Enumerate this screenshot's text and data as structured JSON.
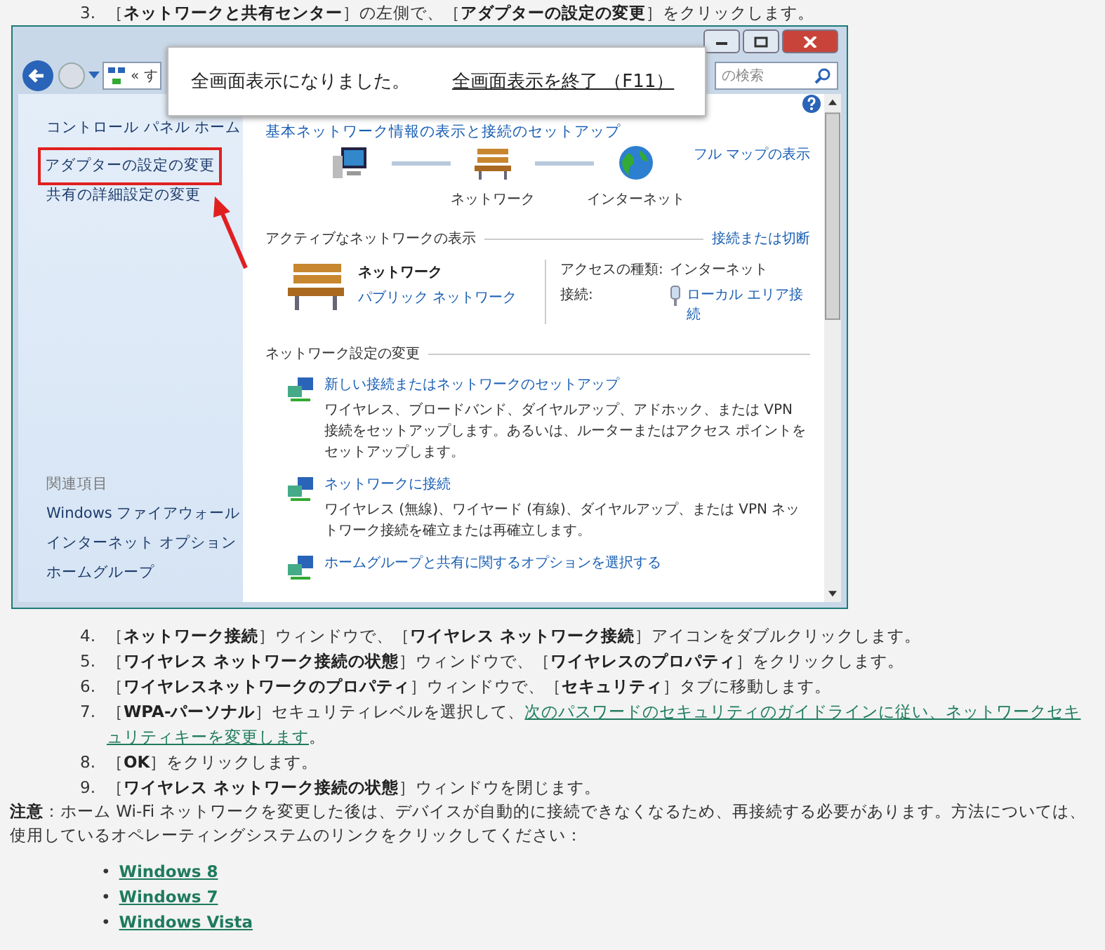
{
  "intro_step": {
    "number": "3.",
    "text": "［**ネットワークと共有センター**］の左側で、［**アダプターの設定の変更**］をクリックします。"
  },
  "screenshot": {
    "address": "« す",
    "search_placeholder": "の検索",
    "banner": {
      "message": "全画面表示になりました。",
      "exit_link": "全画面表示を終了 （F11）"
    },
    "sidebar": {
      "home": "コントロール パネル ホーム",
      "items": [
        {
          "label": "アダプターの設定の変更",
          "highlighted": true
        },
        {
          "label": "共有の詳細設定の変更",
          "highlighted": false
        }
      ],
      "related_heading": "関連項目",
      "related": [
        "Windows ファイアウォール",
        "インターネット オプション",
        "ホームグループ"
      ]
    },
    "main": {
      "heading": "基本ネットワーク情報の表示と接続のセットアップ",
      "full_map_link": "フル マップの表示",
      "map_nodes": [
        {
          "kind": "computer"
        },
        {
          "kind": "bench",
          "label": "ネットワーク"
        },
        {
          "kind": "globe",
          "label": "インターネット"
        }
      ],
      "active_heading": "アクティブなネットワークの表示",
      "connect_link": "接続または切断",
      "network_name": "ネットワーク",
      "network_type": "パブリック ネットワーク",
      "access_label": "アクセスの種類:",
      "access_value": "インターネット",
      "connection_label": "接続:",
      "connection_value": "ローカル エリア接続",
      "change_heading": "ネットワーク設定の変更",
      "tasks": [
        {
          "title": "新しい接続またはネットワークのセットアップ",
          "description": "ワイヤレス、ブロードバンド、ダイヤルアップ、アドホック、または VPN 接続をセットアップします。あるいは、ルーターまたはアクセス ポイントをセットアップします。"
        },
        {
          "title": "ネットワークに接続",
          "description": "ワイヤレス (無線)、ワイヤード (有線)、ダイヤルアップ、または VPN ネットワーク接続を確立または再確立します。"
        },
        {
          "title": "ホームグループと共有に関するオプションを選択する"
        }
      ]
    }
  },
  "steps": [
    {
      "number": "4.",
      "text": "［**ネットワーク接続**］ウィンドウで、［**ワイヤレス ネットワーク接続**］アイコンをダブルクリックします。"
    },
    {
      "number": "5.",
      "text": "［**ワイヤレス ネットワーク接続の状態**］ウィンドウで、［**ワイヤレスのプロパティ**］をクリックします。"
    },
    {
      "number": "6.",
      "text": "［**ワイヤレスネットワークのプロパティ**］ウィンドウで、［**セキュリティ**］タブに移動します。"
    },
    {
      "number": "7.",
      "text": "［**WPA-パーソナル**］セキュリティレベルを選択して、",
      "link": "次のパスワードのセキュリティのガイドラインに従い、ネットワークセキュリティキーを変更します",
      "after": "。"
    },
    {
      "number": "8.",
      "text": "［**OK**］をクリックします。"
    },
    {
      "number": "9.",
      "text": "［**ワイヤレス ネットワーク接続の状態**］ウィンドウを閉じます。"
    }
  ],
  "note": {
    "label": "注意",
    "text": "：ホーム Wi-Fi ネットワークを変更した後は、デバイスが自動的に接続できなくなるため、再接続する必要があります。方法については、使用しているオペレーティングシステムのリンクをクリックしてください："
  },
  "os_links": [
    {
      "bullet": "•",
      "label": "Windows 8"
    },
    {
      "bullet": "•",
      "label": "Windows 7"
    },
    {
      "bullet": "•",
      "label": "Windows Vista"
    }
  ]
}
